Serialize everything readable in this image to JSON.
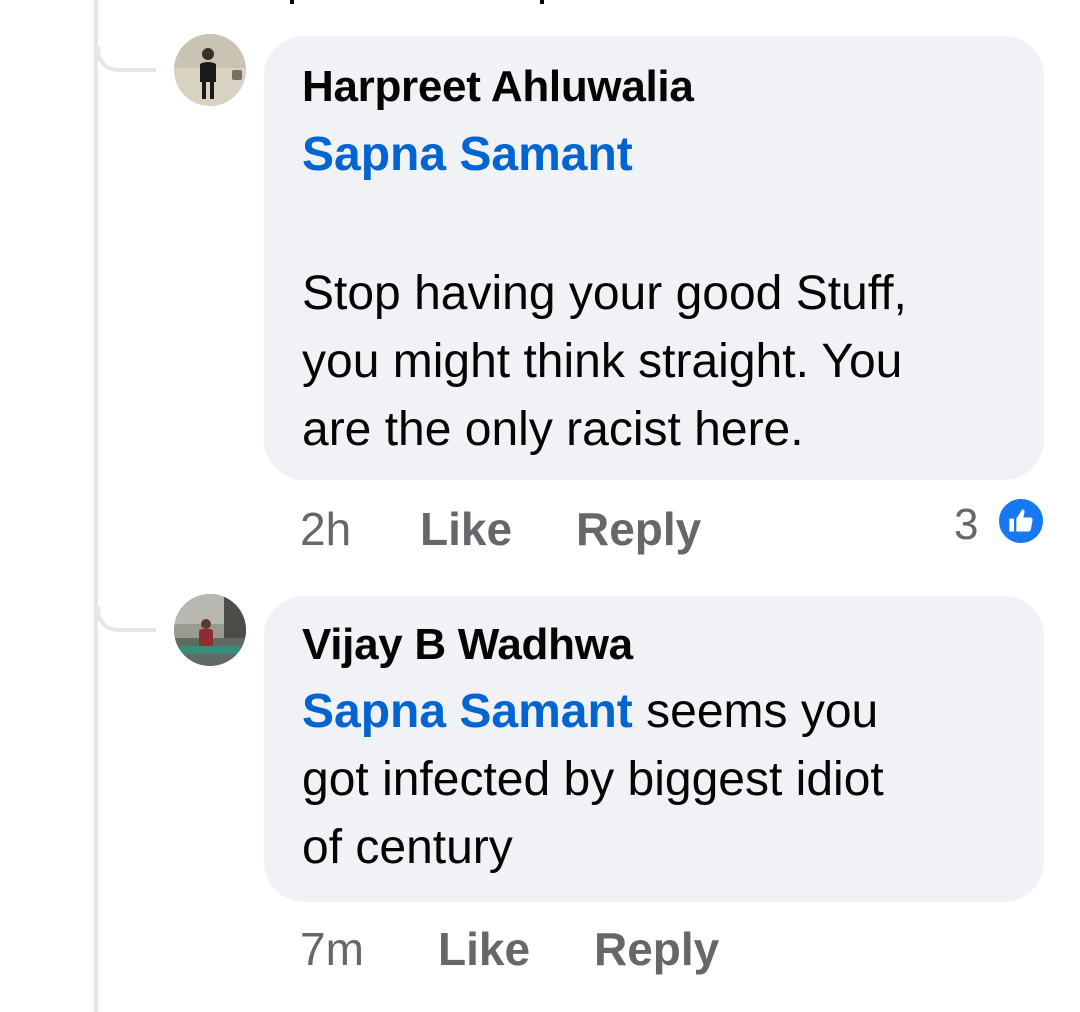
{
  "colors": {
    "background": "#ffffff",
    "bubble": "#f0f2f5",
    "mention": "#0064d1",
    "meta": "#65676b",
    "like_badge": "#1877f2",
    "thread_line": "#e4e6eb"
  },
  "comments": [
    {
      "author": "Harpreet Ahluwalia",
      "avatar_icon": "avatar-person-standing",
      "mention": "Sapna Samant",
      "lines": [
        "Stop having your good Stuff,",
        "you might think straight. You",
        "are the only racist here."
      ],
      "time": "2h",
      "like_label": "Like",
      "reply_label": "Reply",
      "reaction_count": "3",
      "reaction_icon": "thumbs-up-icon"
    },
    {
      "author": "Vijay B Wadhwa",
      "avatar_icon": "avatar-person-outdoor",
      "mention": "Sapna Samant",
      "first_line_rest": " seems you",
      "lines": [
        "got infected by biggest idiot",
        "of century"
      ],
      "time": "7m",
      "like_label": "Like",
      "reply_label": "Reply"
    }
  ]
}
